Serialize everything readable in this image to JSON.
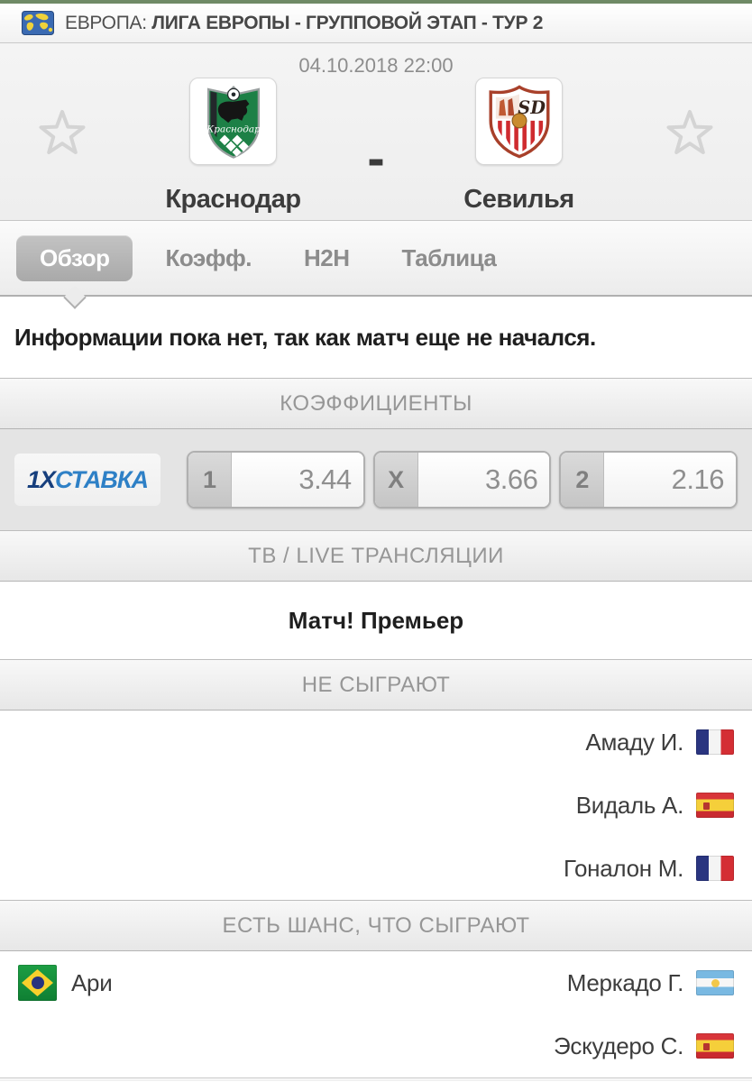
{
  "league_header": {
    "region": "ЕВРОПА:",
    "competition": "ЛИГА ЕВРОПЫ - ГРУППОВОЙ ЭТАП - ТУР 2",
    "icon": "world-map-icon"
  },
  "match": {
    "datetime": "04.10.2018 22:00",
    "separator": "-",
    "home": {
      "name": "Краснодар",
      "logo": "krasnodar-crest"
    },
    "away": {
      "name": "Севилья",
      "logo": "sevilla-crest"
    }
  },
  "tabs": [
    {
      "label": "Обзор",
      "selected": true
    },
    {
      "label": "Коэфф.",
      "selected": false
    },
    {
      "label": "H2H",
      "selected": false
    },
    {
      "label": "Таблица",
      "selected": false
    }
  ],
  "info_message": "Информации пока нет, так как матч еще не начался.",
  "odds_section": {
    "header": "КОЭФФИЦИЕНТЫ",
    "bookmaker_prefix": "1X",
    "bookmaker_rest": "СТАВКА",
    "bookmaker_color_dark": "#173f7d",
    "bookmaker_color_light": "#2e80c6",
    "odds": [
      {
        "label": "1",
        "value": "3.44"
      },
      {
        "label": "X",
        "value": "3.66"
      },
      {
        "label": "2",
        "value": "2.16"
      }
    ]
  },
  "tv_section": {
    "header": "ТВ / LIVE ТРАНСЛЯЦИИ",
    "channel": "Матч! Премьер"
  },
  "out_section": {
    "header": "НЕ СЫГРАЮТ",
    "away_players": [
      {
        "name": "Амаду И.",
        "flag": "fr",
        "flag_name": "france-flag-icon"
      },
      {
        "name": "Видаль А.",
        "flag": "es",
        "flag_name": "spain-flag-icon"
      },
      {
        "name": "Гоналон М.",
        "flag": "fr",
        "flag_name": "france-flag-icon"
      }
    ]
  },
  "chance_section": {
    "header": "ЕСТЬ ШАНС, ЧТО СЫГРАЮТ",
    "home_players": [
      {
        "name": "Ари",
        "flag": "br",
        "flag_name": "brazil-flag-icon"
      }
    ],
    "away_players": [
      {
        "name": "Меркадо Г.",
        "flag": "ar",
        "flag_name": "argentina-flag-icon"
      },
      {
        "name": "Эскудеро С.",
        "flag": "es",
        "flag_name": "spain-flag-icon"
      }
    ]
  }
}
